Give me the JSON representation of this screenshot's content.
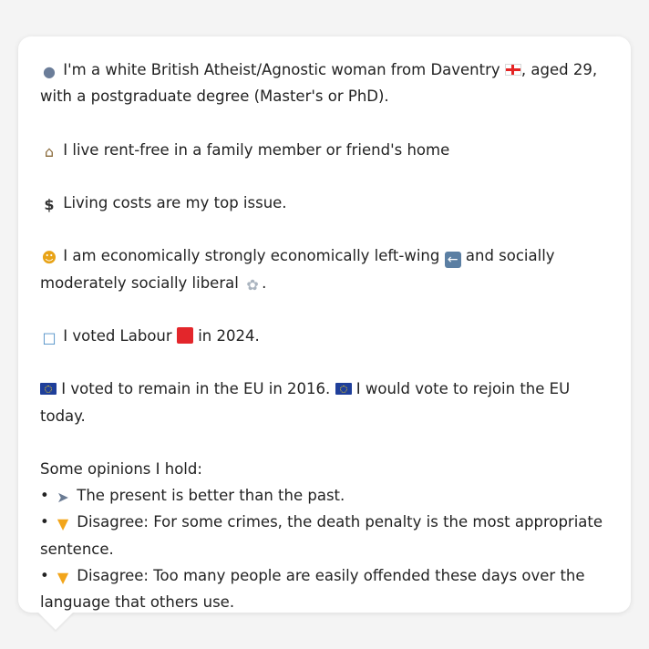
{
  "profile": {
    "intro": {
      "text_before_flag": "I'm a white British Atheist/Agnostic woman from Daventry",
      "text_after_flag": ", aged 29, with a postgraduate degree (Master's or PhD).",
      "person_icon": "person-silhouette-icon",
      "flag_icon": "england-flag-icon"
    },
    "housing": {
      "icon": "house-icon",
      "text": "I live rent-free in a family member or friend's home"
    },
    "top_issue": {
      "icon": "dollar-sign-icon",
      "text": "Living costs are my top issue."
    },
    "ideology": {
      "icon": "thinking-face-icon",
      "text_before_arrow": "I am economically strongly economically left-wing",
      "text_middle": "and socially moderately socially liberal",
      "arrow_icon": "left-arrow-icon",
      "dove_icon": "dove-icon",
      "text_end": "."
    },
    "vote_2024": {
      "icon": "ballot-box-icon",
      "text_before_party": "I voted Labour",
      "party_icon": "red-square-icon",
      "party_color": "#e3262b",
      "text_after_party": "in 2024."
    },
    "eu": {
      "icon": "eu-flag-icon",
      "text_2016": "I voted to remain in the EU in 2016.",
      "text_today": "I would vote to rejoin the EU today."
    },
    "opinions": {
      "heading": "Some opinions I hold:",
      "bullet": "•",
      "items": [
        {
          "icon": "rocket-icon",
          "text": "The present is better than the past."
        },
        {
          "icon": "thumbs-down-icon",
          "text": "Disagree: For some crimes, the death penalty is the most appropriate sentence."
        },
        {
          "icon": "thumbs-down-icon",
          "text": "Disagree: Too many people are easily offended these days over the language that others use."
        }
      ]
    }
  }
}
